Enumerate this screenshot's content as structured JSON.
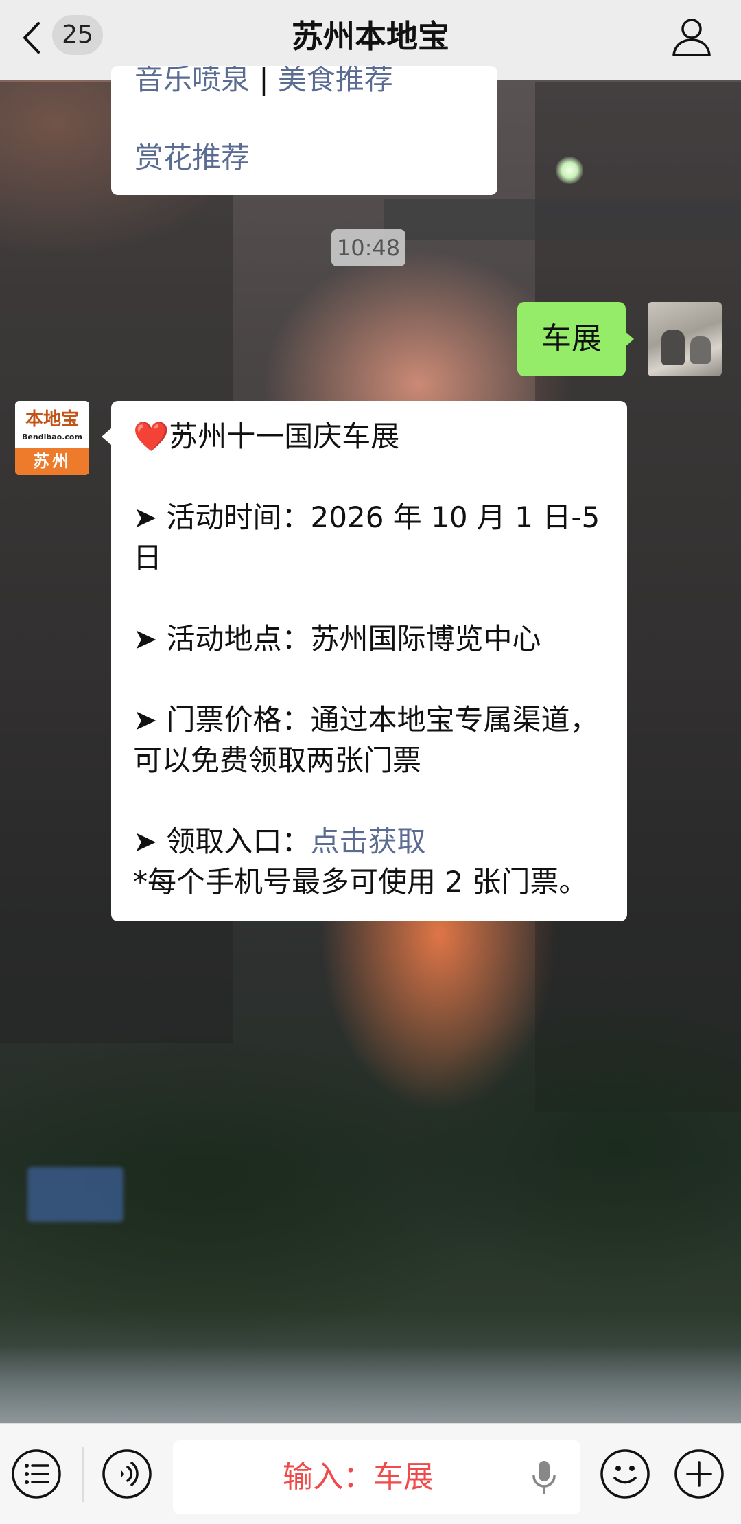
{
  "header": {
    "back_count": "25",
    "title": "苏州本地宝"
  },
  "chat": {
    "previous_message": {
      "line1_left": "音乐喷泉",
      "line1_sep": " | ",
      "line1_right": "美食推荐",
      "line2": "赏花推荐"
    },
    "timestamp": "10:48",
    "user_message": "车展",
    "bot_avatar": {
      "brand": "本地宝",
      "site": "Bendibao.com",
      "city": "苏州"
    },
    "bot_message": {
      "title": "❤️苏州十一国庆车展",
      "time_line": "➤ 活动时间：2026 年 10 月 1 日-5 日",
      "place_line": "➤ 活动地点：苏州国际博览中心",
      "price_line": "➤ 门票价格：通过本地宝专属渠道，可以免费领取两张门票",
      "entry_prefix": "➤ 领取入口：",
      "entry_link": "点击获取",
      "note": "*每个手机号最多可使用 2 张门票。"
    }
  },
  "input_bar": {
    "hint": "输入：车展"
  },
  "colors": {
    "user_bubble": "#95ec69",
    "link": "#5b6c93",
    "input_hint": "#f04a4a",
    "topbar": "#ededed"
  },
  "icons": {
    "back": "chevron-left-icon",
    "profile": "person-icon",
    "menu": "list-icon",
    "voice": "voice-icon",
    "mic": "mic-icon",
    "emoji": "emoji-icon",
    "more": "plus-icon"
  }
}
